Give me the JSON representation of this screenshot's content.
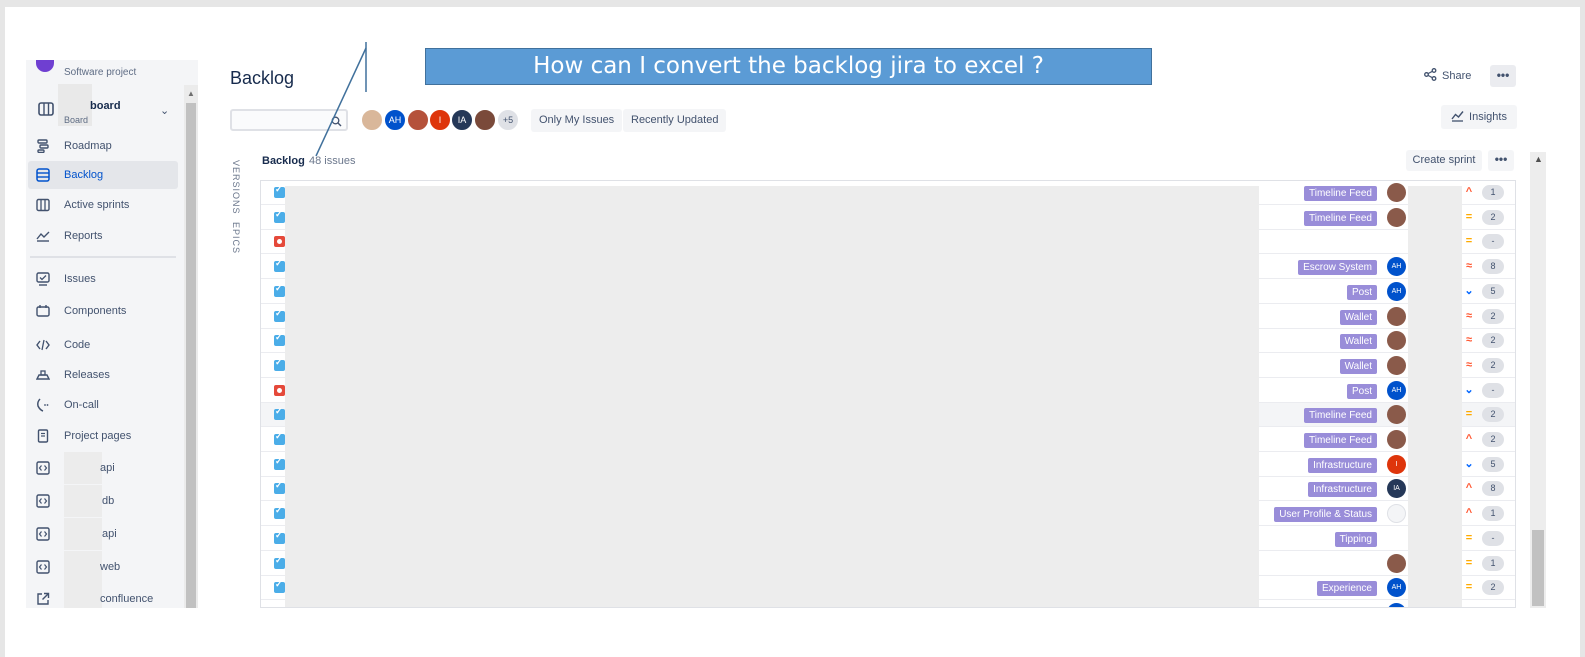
{
  "project": {
    "type": "Software project"
  },
  "board": {
    "name": "board",
    "sublabel": "Board"
  },
  "sidebar": {
    "items": [
      {
        "label": "Roadmap",
        "icon": "roadmap-icon"
      },
      {
        "label": "Backlog",
        "icon": "backlog-icon"
      },
      {
        "label": "Active sprints",
        "icon": "active-sprints-icon"
      },
      {
        "label": "Reports",
        "icon": "reports-icon"
      },
      {
        "label": "Issues",
        "icon": "issues-icon"
      },
      {
        "label": "Components",
        "icon": "components-icon"
      },
      {
        "label": "Code",
        "icon": "code-icon"
      },
      {
        "label": "Releases",
        "icon": "releases-icon"
      },
      {
        "label": "On-call",
        "icon": "on-call-icon"
      },
      {
        "label": "Project pages",
        "icon": "project-pages-icon"
      },
      {
        "label": "api",
        "icon": "repo-icon"
      },
      {
        "label": "db",
        "icon": "repo-icon"
      },
      {
        "label": "api",
        "icon": "repo-icon"
      },
      {
        "label": "web",
        "icon": "repo-icon"
      },
      {
        "label": "confluence",
        "icon": "external-link-icon"
      }
    ]
  },
  "page": {
    "title": "Backlog"
  },
  "annotation": {
    "text": "How can I convert the backlog jira to excel ?"
  },
  "header": {
    "share": "Share",
    "more": "•••",
    "insights": "Insights"
  },
  "filters": {
    "avatars": [
      {
        "initials": "",
        "color": "#d9b79a"
      },
      {
        "initials": "AH",
        "color": "#0052cc"
      },
      {
        "initials": "",
        "color": "#b5523b"
      },
      {
        "initials": "I",
        "color": "#de350b"
      },
      {
        "initials": "IA",
        "color": "#253858"
      },
      {
        "initials": "",
        "color": "#7a4a3a"
      },
      {
        "initials": "+5",
        "color": "#dfe1e6"
      }
    ],
    "only_my_issues": "Only My Issues",
    "recently_updated": "Recently Updated"
  },
  "side_tabs": {
    "versions": "VERSIONS",
    "epics": "EPICS"
  },
  "backlog": {
    "title": "Backlog",
    "count": "48 issues",
    "create_sprint": "Create sprint",
    "more": "•••",
    "rows": [
      {
        "type": "story",
        "epic": "Timeline Feed",
        "assignee": "photo",
        "priority": "high",
        "points": "1"
      },
      {
        "type": "story",
        "epic": "Timeline Feed",
        "assignee": "photo",
        "priority": "medium",
        "points": "2"
      },
      {
        "type": "bug",
        "epic": "",
        "assignee": "",
        "priority": "medium",
        "points": "-"
      },
      {
        "type": "story",
        "epic": "Escrow System",
        "assignee": "AH",
        "priority": "highest",
        "points": "8"
      },
      {
        "type": "story",
        "epic": "Post",
        "assignee": "AH",
        "priority": "low",
        "points": "5"
      },
      {
        "type": "story",
        "epic": "Wallet",
        "assignee": "photo",
        "priority": "highest",
        "points": "2"
      },
      {
        "type": "story",
        "epic": "Wallet",
        "assignee": "photo",
        "priority": "highest",
        "points": "2"
      },
      {
        "type": "story",
        "epic": "Wallet",
        "assignee": "photo",
        "priority": "highest",
        "points": "2"
      },
      {
        "type": "bug",
        "epic": "Post",
        "assignee": "AH",
        "priority": "low",
        "points": "-"
      },
      {
        "type": "story",
        "epic": "Timeline Feed",
        "assignee": "photo",
        "priority": "medium",
        "points": "2"
      },
      {
        "type": "story",
        "epic": "Timeline Feed",
        "assignee": "photo",
        "priority": "high",
        "points": "2"
      },
      {
        "type": "story",
        "epic": "Infrastructure",
        "assignee": "I",
        "priority": "low",
        "points": "5"
      },
      {
        "type": "story",
        "epic": "Infrastructure",
        "assignee": "IA",
        "priority": "high",
        "points": "8"
      },
      {
        "type": "story",
        "epic": "User Profile & Status",
        "assignee": "sketch",
        "priority": "high",
        "points": "1"
      },
      {
        "type": "story",
        "epic": "Tipping",
        "assignee": "",
        "priority": "medium",
        "points": "-"
      },
      {
        "type": "story",
        "epic": "",
        "assignee": "photo",
        "priority": "medium",
        "points": "1"
      },
      {
        "type": "story",
        "epic": "Experience",
        "assignee": "AH",
        "priority": "medium",
        "points": "2"
      },
      {
        "type": "story",
        "epic": "",
        "assignee": "AH",
        "priority": "medium",
        "points": ""
      }
    ]
  },
  "colors": {
    "accent": "#0052cc",
    "epic": "#998dd9",
    "story": "#4bade8",
    "bug": "#e5493a",
    "priority_high": "#ff5630",
    "priority_medium": "#ffab00",
    "priority_low": "#0065ff",
    "annotation_box": "#5b9bd5"
  }
}
